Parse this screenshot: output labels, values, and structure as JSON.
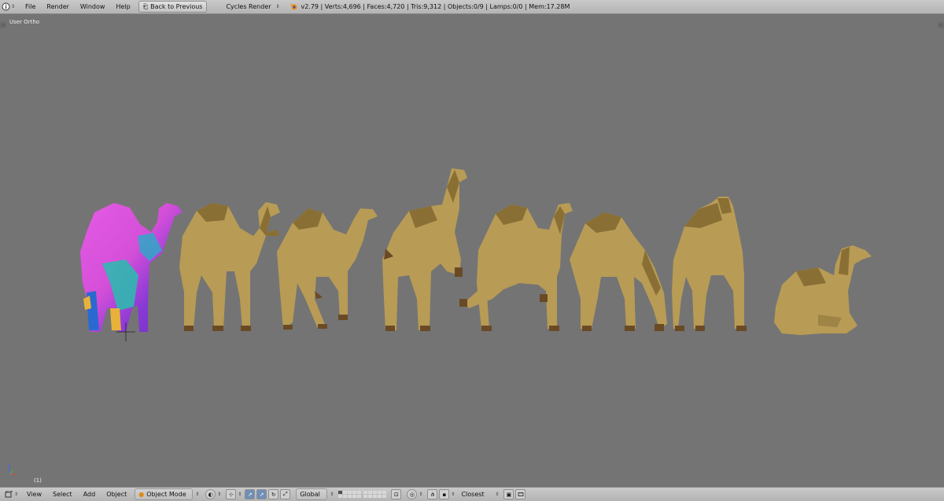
{
  "header": {
    "menus": [
      "File",
      "Render",
      "Window",
      "Help"
    ],
    "back_button": "Back to Previous",
    "render_engine": "Cycles Render",
    "stats": "v2.79 | Verts:4,696 | Faces:4,720 | Tris:9,312 | Objects:0/9 | Lamps:0/0 | Mem:17.28M",
    "icon_editor": "info-editor-icon",
    "icon_blender": "blender-logo-icon"
  },
  "viewport": {
    "view_label": "User Ortho",
    "frame_label": "(1)",
    "camel_count": 8,
    "background_color": "#747474",
    "camel_color": "#b89b55",
    "camel_shadow_color": "#8a6f35",
    "uv_colors": [
      "#e05ae0",
      "#8a3ad6",
      "#2fb8b0",
      "#2a6ad0",
      "#e8b23a"
    ]
  },
  "footer": {
    "menus": [
      "View",
      "Select",
      "Add",
      "Object"
    ],
    "mode": "Object Mode",
    "orientation": "Global",
    "snap": "Closest"
  },
  "colors": {
    "header_bg": "#c0c0c0",
    "viewport_bg": "#747474",
    "active_button": "#6f8fb6"
  }
}
